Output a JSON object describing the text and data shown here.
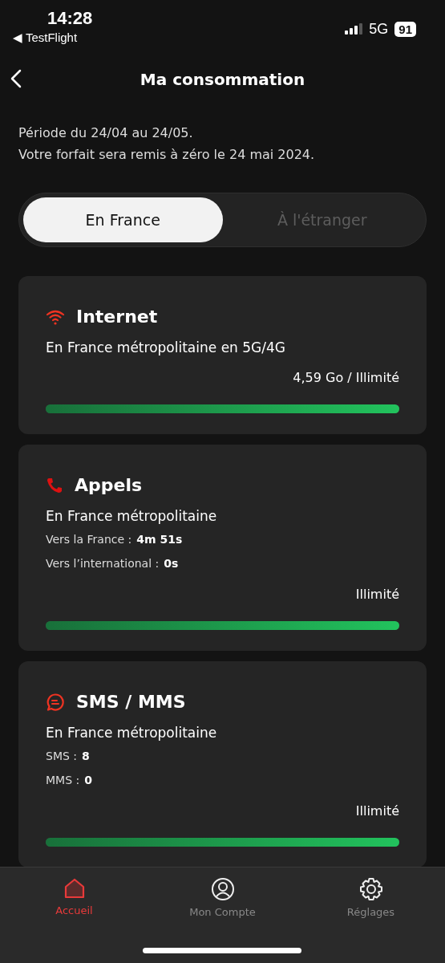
{
  "status_bar": {
    "time": "14:28",
    "back_app": "◀ TestFlight",
    "network": "5G",
    "battery": "91"
  },
  "header": {
    "title": "Ma consommation"
  },
  "period": [
    "Période du 24/04 au 24/05.",
    "Votre forfait sera remis à zéro le 24 mai 2024."
  ],
  "segments": [
    {
      "label": "En France",
      "selected": true
    },
    {
      "label": "À l'étranger",
      "selected": false
    }
  ],
  "cards": [
    {
      "kind": "wifi",
      "title": "Internet",
      "subtitle": "En France métropolitaine en 5G/4G",
      "usage": "4,59 Go / Illimité",
      "level": 1
    },
    {
      "kind": "phone",
      "title": "Appels",
      "subtitle": "En France métropolitaine",
      "details": [
        {
          "label": "Vers la France :",
          "value": "4m 51s"
        },
        {
          "label": "Vers l’international :",
          "value": "0s"
        }
      ],
      "usage": "Illimité",
      "level": 1
    },
    {
      "kind": "message",
      "title": "SMS / MMS",
      "subtitle": "En France métropolitaine",
      "details": [
        {
          "label": "SMS :",
          "value": "8"
        },
        {
          "label": "MMS :",
          "value": "0"
        }
      ],
      "usage": "Illimité",
      "level": 1
    }
  ],
  "tab_bar": [
    {
      "kind": "home",
      "label": "Accueil",
      "selected": true
    },
    {
      "kind": "account",
      "label": "Mon Compte",
      "selected": false
    },
    {
      "kind": "settings",
      "label": "Réglages",
      "selected": false
    }
  ]
}
